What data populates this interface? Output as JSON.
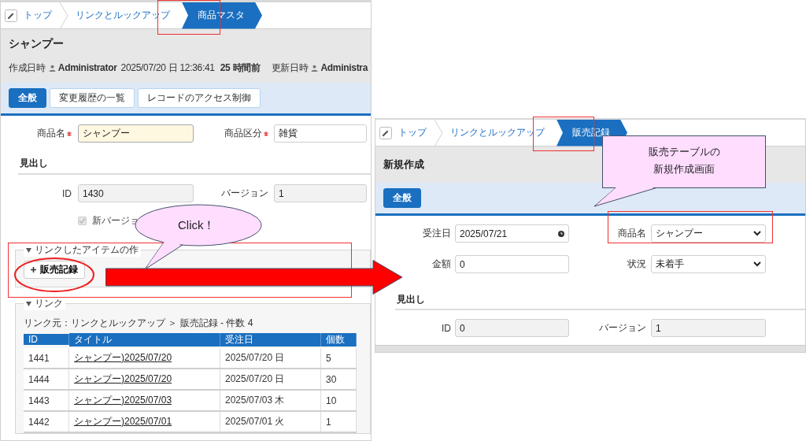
{
  "source_screen": {
    "breadcrumb": [
      {
        "label": "トップ",
        "selected": false
      },
      {
        "label": "リンクとルックアップ",
        "selected": false
      },
      {
        "label": "商品マスタ",
        "selected": true
      }
    ],
    "title": "シャンプー",
    "meta": [
      {
        "kind": "label",
        "text": "作成日時"
      },
      {
        "kind": "user",
        "text": "Administrator"
      },
      {
        "kind": "plain",
        "text": "2025/07/20 日 12:36:41"
      },
      {
        "kind": "strong",
        "text": "25 時間前"
      },
      {
        "kind": "label",
        "text": "更新日時"
      },
      {
        "kind": "user",
        "text": "Administra"
      }
    ],
    "tabs": [
      {
        "label": "全般",
        "selected": true
      },
      {
        "label": "変更履歴の一覧",
        "selected": false
      },
      {
        "label": "レコードのアクセス制御",
        "selected": false
      }
    ],
    "fields": [
      {
        "label": "商品名",
        "required": true,
        "value": "シャンプー",
        "focused": true
      },
      {
        "label": "商品区分",
        "required": true,
        "value": "雑貨",
        "focused": false
      }
    ],
    "heading": "見出し",
    "info_fields": [
      {
        "label": "ID",
        "value": "1430"
      },
      {
        "label": "バージョン",
        "value": "1"
      }
    ],
    "checkbox": {
      "label": "新バージョ",
      "checked": true
    },
    "link_create": {
      "legend": "リンクしたアイテムの作",
      "expanded": true,
      "button": "販売記録"
    },
    "links": {
      "legend": "リンク",
      "expanded": true,
      "source": "リンク元：リンクとルックアップ ＞ 販売記録 - 件数 4",
      "table": {
        "columns": [
          "ID",
          "タイトル",
          "受注日",
          "個数"
        ],
        "rows": [
          [
            "1441",
            "シャンプー)2025/07/20",
            "2025/07/20 日",
            "5"
          ],
          [
            "1444",
            "シャンプー)2025/07/20",
            "2025/07/20 日",
            "30"
          ],
          [
            "1443",
            "シャンプー)2025/07/03",
            "2025/07/03 木",
            "10"
          ],
          [
            "1442",
            "シャンプー)2025/07/01",
            "2025/07/01 火",
            "1"
          ]
        ]
      }
    }
  },
  "target_screen": {
    "breadcrumb": [
      {
        "label": "トップ",
        "selected": false
      },
      {
        "label": "リンクとルックアップ",
        "selected": false
      },
      {
        "label": "販売記録",
        "selected": true
      }
    ],
    "title": "新規作成",
    "tabs": [
      {
        "label": "全般",
        "selected": true
      }
    ],
    "fields": [
      {
        "label": "受注日",
        "value": "2025/07/21",
        "kind": "date"
      },
      {
        "label": "商品名",
        "value": "シャンプー",
        "kind": "select"
      },
      {
        "label": "金額",
        "value": "0",
        "kind": "text"
      },
      {
        "label": "状況",
        "value": "未着手",
        "kind": "select"
      }
    ],
    "heading": "見出し",
    "info_fields": [
      {
        "label": "ID",
        "value": "0"
      },
      {
        "label": "バージョン",
        "value": "1"
      }
    ]
  },
  "annotations": {
    "click_callout": "Click！",
    "screen_callout": [
      "販売テーブルの",
      "新規作成画面"
    ]
  }
}
